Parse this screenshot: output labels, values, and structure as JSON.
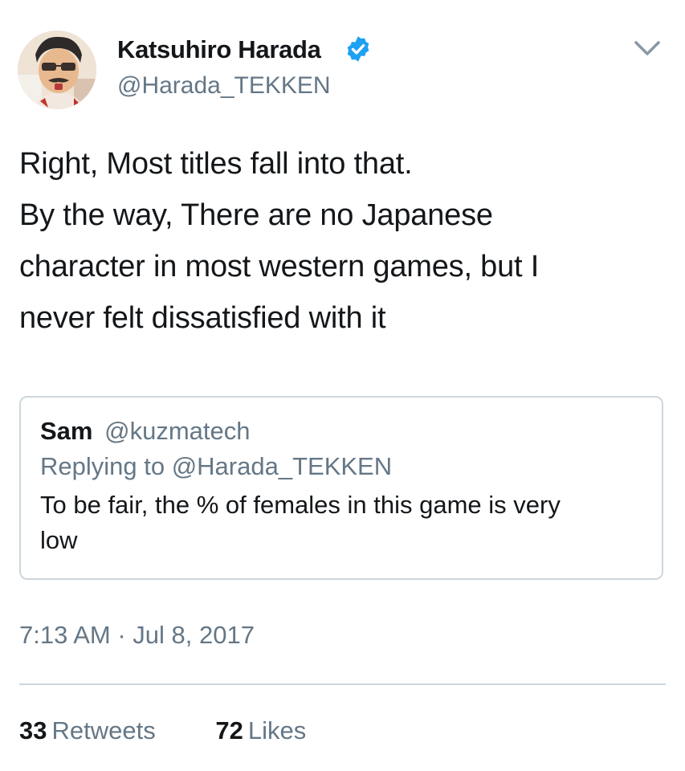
{
  "tweet": {
    "author": {
      "display_name": "Katsuhiro Harada",
      "handle": "@Harada_TEKKEN",
      "verified": true,
      "avatar_icon": "cartoon-avatar"
    },
    "menu_icon": "chevron-down-icon",
    "text_lines": [
      "Right, Most titles fall into that.",
      "By the way, There are no Japanese",
      "character in most western games, but I",
      "never felt dissatisfied with it"
    ],
    "quoted": {
      "name": "Sam",
      "handle": "@kuzmatech",
      "replying_to": "Replying to @Harada_TEKKEN",
      "text_lines": [
        "To be fair, the % of females in this game is very",
        "low"
      ]
    },
    "timestamp": "7:13 AM · Jul 8, 2017",
    "stats": {
      "retweets_count": "33",
      "retweets_label": "Retweets",
      "likes_count": "72",
      "likes_label": "Likes"
    }
  },
  "colors": {
    "text": "#14171a",
    "secondary": "#657786",
    "border": "#ccd6dd",
    "verified": "#1da1f2"
  }
}
